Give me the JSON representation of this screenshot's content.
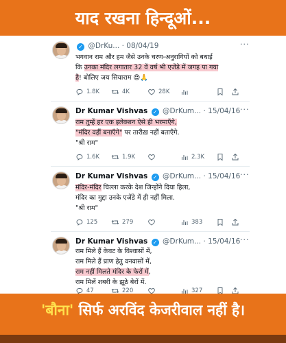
{
  "header": {
    "title": "याद रखना हिन्दूओं..."
  },
  "tweets": [
    {
      "name": "",
      "handle": "@DrKu...",
      "date": "· 08/04/19",
      "lines": [
        [
          {
            "t": "भगवान ",
            "h": false
          },
          {
            "t": "राम",
            "h": false
          },
          {
            "t": " और हम जैसे उनके चरण-अनुरागियों को बधाई",
            "h": false
          }
        ],
        [
          {
            "t": "कि ",
            "h": false
          },
          {
            "t": "उनका मंदिर लगातार 32 वें वर्ष भी एजेंडे में जगह पा गया",
            "h": true
          }
        ],
        [
          {
            "t": "है",
            "h": true
          },
          {
            "t": "! बोलिए जय सियाराम 😍🙏",
            "h": false
          }
        ]
      ],
      "reply": "1.8K",
      "retweet": "4K",
      "like": "28K",
      "views": ""
    },
    {
      "name": "Dr Kumar Vishvas",
      "handle": "@DrKum...",
      "date": "· 15/04/16",
      "lines": [
        [
          {
            "t": "राम तुम्हें हर एक इलेक्शन ऐसे ही भरमाएँगे,",
            "h": true
          }
        ],
        [
          {
            "t": "\"मंदिर वहीं बनाएँगे\"",
            "h": true
          },
          {
            "t": " पर तारीख़ नहीं बताएँगे.",
            "h": false
          }
        ],
        [
          {
            "t": "\"श्री राम\"",
            "h": false
          }
        ]
      ],
      "reply": "1.6K",
      "retweet": "1.9K",
      "like": "",
      "views": "2.3K"
    },
    {
      "name": "Dr Kumar Vishvas",
      "handle": "@DrKum...",
      "date": "· 15/04/16",
      "lines": [
        [
          {
            "t": "मंदिर-मंदिर",
            "h": true
          },
          {
            "t": " चिल्ला करके देश जिन्होंने दिया हिला,",
            "h": false
          }
        ],
        [
          {
            "t": "मंदिर",
            "h": false
          },
          {
            "t": " का मुद्दा उनके एजेंडे में ही नहीं मिला.",
            "h": false
          }
        ],
        [
          {
            "t": "\"श्री राम\"",
            "h": false
          }
        ]
      ],
      "reply": "125",
      "retweet": "279",
      "like": "",
      "views": "383"
    },
    {
      "name": "Dr Kumar Vishvas",
      "handle": "@DrKum...",
      "date": "· 15/04/16",
      "lines": [
        [
          {
            "t": "राम मिले हैं केवट के विश्वासों में,",
            "h": false
          }
        ],
        [
          {
            "t": "राम मिले हैं प्राण हेतु वनवासों में,",
            "h": false
          }
        ],
        [
          {
            "t": "राम नहीं मिलते मंदिर के फेरों में",
            "h": true
          },
          {
            "t": ",",
            "h": false
          }
        ],
        [
          {
            "t": "राम मिलें शबरी के झूठे बेरों में.",
            "h": false
          }
        ]
      ],
      "reply": "47",
      "retweet": "220",
      "like": "",
      "views": "327"
    }
  ],
  "footer": {
    "quoted": "'बौना'",
    "rest": " सिर्फ अरविंद केजरीवाल नहीं है।"
  },
  "colors": {
    "banner": "#e8731a",
    "highlight": "#f8c9cf",
    "verified": "#1d9bf0"
  },
  "icons": [
    "reply-icon",
    "retweet-icon",
    "like-icon",
    "views-icon",
    "bookmark-icon",
    "share-icon",
    "more-icon",
    "verified-icon"
  ]
}
